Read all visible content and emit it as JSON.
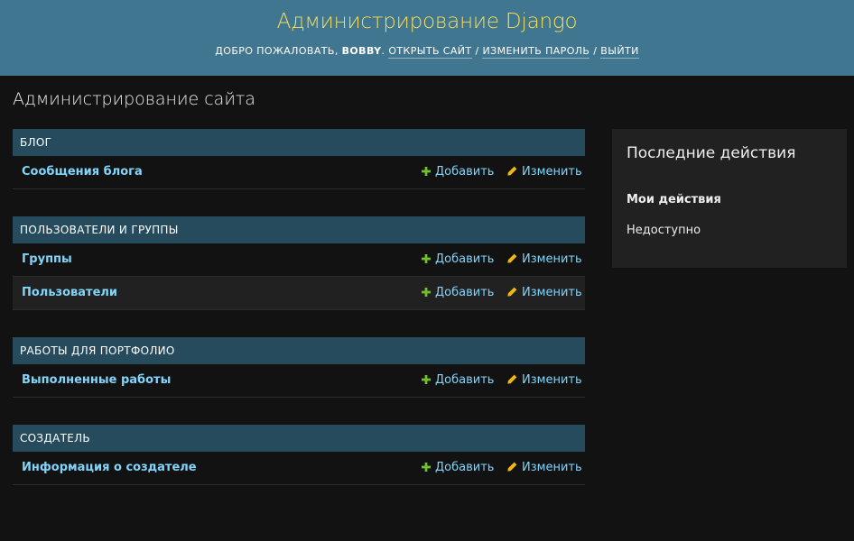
{
  "header": {
    "site_title": "Администрирование Django",
    "welcome": "ДОБРО ПОЖАЛОВАТЬ,",
    "username": "BOBBY",
    "after_user": ".",
    "view_site": "ОТКРЫТЬ САЙТ",
    "separator": "/",
    "change_password": "ИЗМЕНИТЬ ПАРОЛЬ",
    "logout": "ВЫЙТИ"
  },
  "content": {
    "title": "Администрирование сайта"
  },
  "modules": [
    {
      "caption": "БЛОГ",
      "models": [
        {
          "name": "Сообщения блога",
          "add": "Добавить",
          "change": "Изменить"
        }
      ]
    },
    {
      "caption": "ПОЛЬЗОВАТЕЛИ И ГРУППЫ",
      "models": [
        {
          "name": "Группы",
          "add": "Добавить",
          "change": "Изменить"
        },
        {
          "name": "Пользователи",
          "add": "Добавить",
          "change": "Изменить"
        }
      ]
    },
    {
      "caption": "РАБОТЫ ДЛЯ ПОРТФОЛИО",
      "models": [
        {
          "name": "Выполненные работы",
          "add": "Добавить",
          "change": "Изменить"
        }
      ]
    },
    {
      "caption": "СОЗДАТЕЛЬ",
      "models": [
        {
          "name": "Информация о создателе",
          "add": "Добавить",
          "change": "Изменить"
        }
      ]
    }
  ],
  "recent_actions": {
    "title": "Последние действия",
    "my_actions": "Мои действия",
    "empty": "Недоступно"
  },
  "colors": {
    "header_bg": "#417690",
    "branding": "#f5dd5d",
    "module_caption_bg": "#264b5d",
    "link": "#81d4fa",
    "add_icon": "#70bf2b",
    "change_icon": "#efb80b",
    "body_bg": "#121212"
  },
  "icons": {
    "add": "plus-icon",
    "change": "pencil-icon"
  }
}
